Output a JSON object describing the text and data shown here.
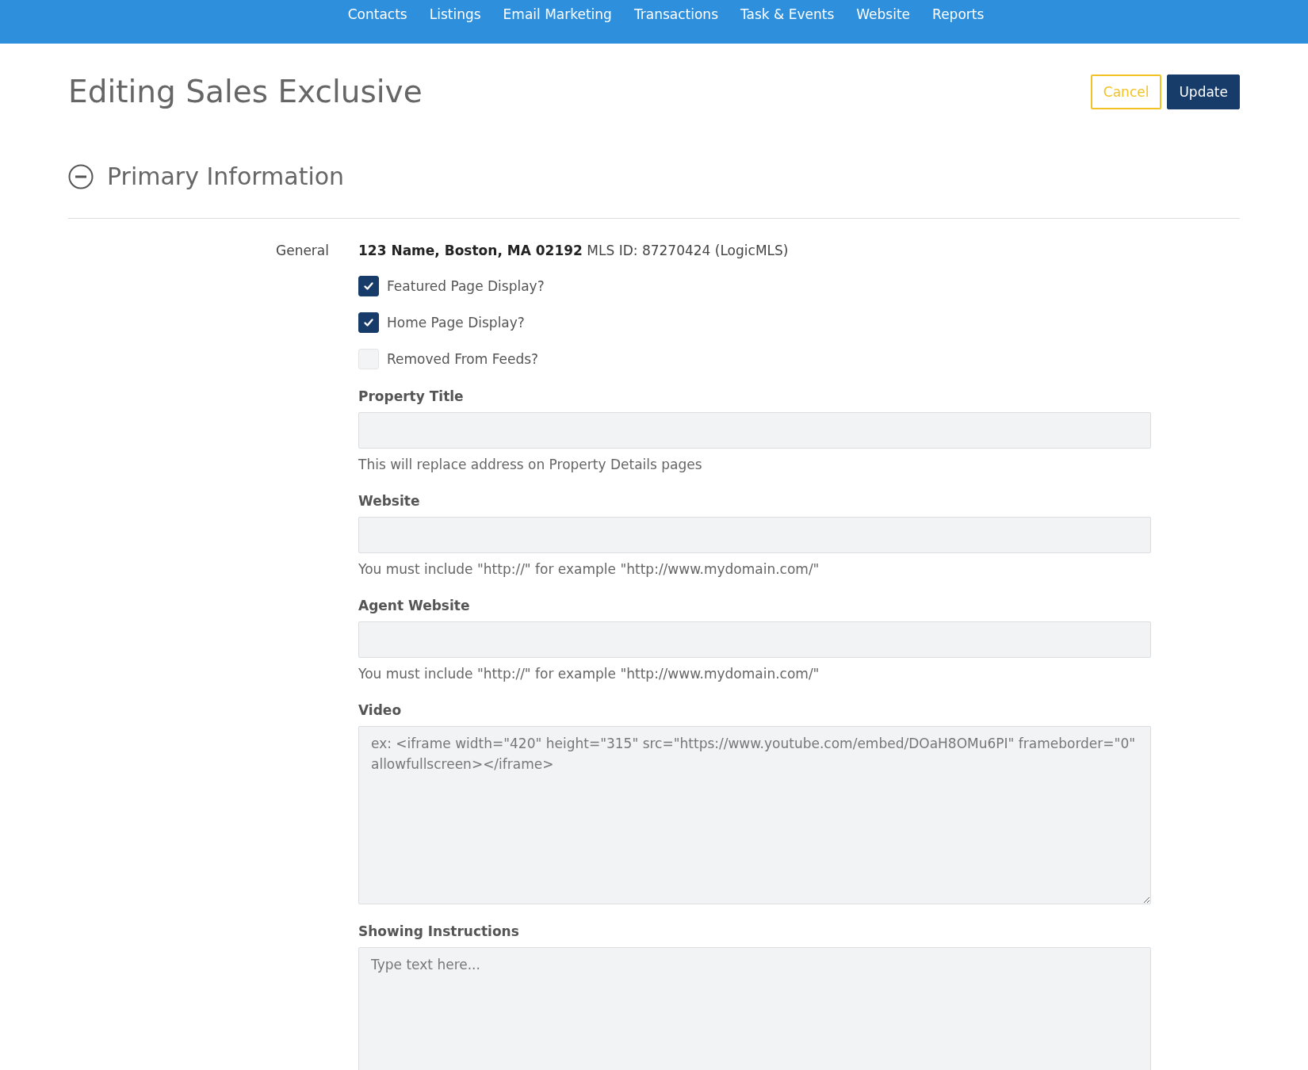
{
  "nav": [
    {
      "label": "Contacts"
    },
    {
      "label": "Listings"
    },
    {
      "label": "Email Marketing"
    },
    {
      "label": "Transactions"
    },
    {
      "label": "Task & Events"
    },
    {
      "label": "Website"
    },
    {
      "label": "Reports"
    }
  ],
  "page_title": "Editing Sales Exclusive",
  "actions": [
    {
      "label": "Cancel",
      "kind": "outline"
    },
    {
      "label": "Update",
      "kind": "primary"
    }
  ],
  "section": {
    "title": "Primary Information",
    "expanded": true
  },
  "general": {
    "label": "General",
    "summary": "**123 Name, Boston, MA 02192** MLS ID: 87270424 (LogicMLS)"
  },
  "checkboxes": [
    {
      "label": "Featured Page Display?",
      "checked": true
    },
    {
      "label": "Home Page Display?",
      "checked": true
    },
    {
      "label": "Removed From Feeds?",
      "checked": false
    }
  ],
  "fields": [
    {
      "label": "Property Title",
      "kind": "input",
      "help": "This will replace address on Property Details pages"
    },
    {
      "label": "Website",
      "kind": "input",
      "help": "You must include \"http://\" for example \"http://www.mydomain.com/\""
    },
    {
      "label": "Agent Website",
      "kind": "input",
      "help": "You must include \"http://\" for example \"http://www.mydomain.com/\""
    },
    {
      "label": "Video",
      "kind": "textarea",
      "placeholder": "ex: <iframe width=\"420\" height=\"315\" src=\"https://www.youtube.com/embed/DOaH8OMu6PI\" frameborder=\"0\" allowfullscreen></iframe>"
    },
    {
      "label": "Showing Instructions",
      "kind": "textarea",
      "placeholder": "Type text here..."
    }
  ]
}
